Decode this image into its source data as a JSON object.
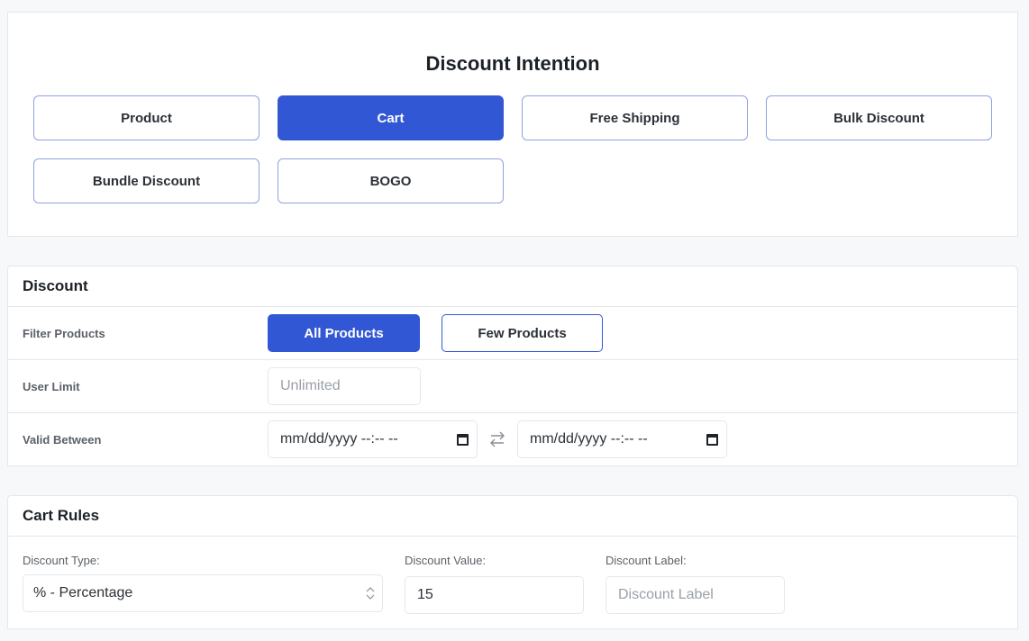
{
  "intention": {
    "title": "Discount Intention",
    "options": [
      {
        "label": "Product",
        "active": false
      },
      {
        "label": "Cart",
        "active": true
      },
      {
        "label": "Free Shipping",
        "active": false
      },
      {
        "label": "Bulk Discount",
        "active": false
      },
      {
        "label": "Bundle Discount",
        "active": false
      },
      {
        "label": "BOGO",
        "active": false
      }
    ]
  },
  "discount": {
    "title": "Discount",
    "filter_products": {
      "label": "Filter Products",
      "options": [
        {
          "label": "All Products",
          "active": true
        },
        {
          "label": "Few Products",
          "active": false
        }
      ]
    },
    "user_limit": {
      "label": "User Limit",
      "value": "",
      "placeholder": "Unlimited"
    },
    "valid_between": {
      "label": "Valid Between",
      "start": "mm/dd/yyyy --:-- --",
      "end": "mm/dd/yyyy --:-- --",
      "swap_icon": "swap-arrows-icon",
      "calendar_icon": "calendar-icon"
    }
  },
  "cart_rules": {
    "title": "Cart Rules",
    "discount_type": {
      "label": "Discount Type:",
      "selected": "% - Percentage"
    },
    "discount_value": {
      "label": "Discount Value:",
      "value": "15"
    },
    "discount_label": {
      "label": "Discount Label:",
      "value": "",
      "placeholder": "Discount Label"
    }
  },
  "colors": {
    "accent": "#3257d4",
    "outline": "#8da2e0",
    "background": "#f7f8fa"
  }
}
